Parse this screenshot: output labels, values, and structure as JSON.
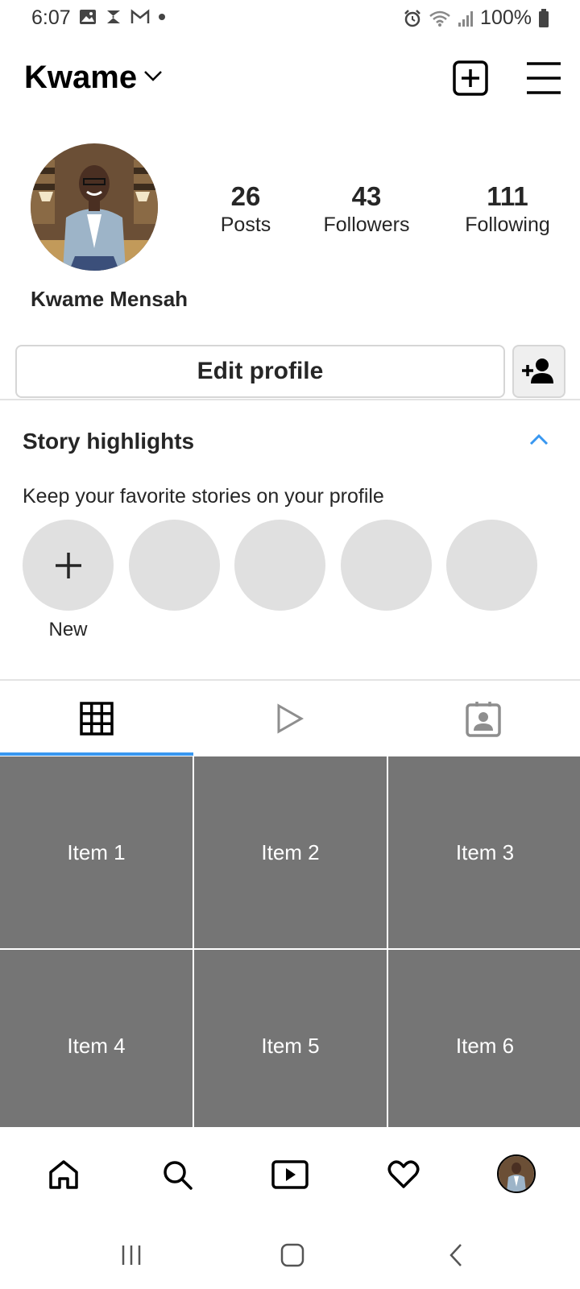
{
  "status_bar": {
    "time": "6:07",
    "battery": "100%",
    "left_icons": [
      "gallery-icon",
      "s-app-icon",
      "gmail-icon",
      "notification-dot-icon"
    ],
    "right_icons": [
      "alarm-icon",
      "wifi-icon",
      "signal-icon",
      "battery-icon"
    ]
  },
  "header": {
    "username": "Kwame",
    "icons": [
      "chevron-down-icon",
      "new-post-icon",
      "menu-icon"
    ]
  },
  "profile": {
    "full_name": "Kwame Mensah",
    "stats": {
      "posts": {
        "value": "26",
        "label": "Posts"
      },
      "followers": {
        "value": "43",
        "label": "Followers"
      },
      "following": {
        "value": "111",
        "label": "Following"
      }
    },
    "edit_profile_label": "Edit profile"
  },
  "highlights": {
    "title": "Story highlights",
    "description": "Keep your favorite stories on your profile",
    "new_label": "New"
  },
  "grid": {
    "items": [
      "Item 1",
      "Item 2",
      "Item 3",
      "Item 4",
      "Item 5",
      "Item 6"
    ]
  },
  "colors": {
    "accent": "#3897f0",
    "grid_tile": "#757575",
    "placeholder": "#e0e0e0"
  }
}
